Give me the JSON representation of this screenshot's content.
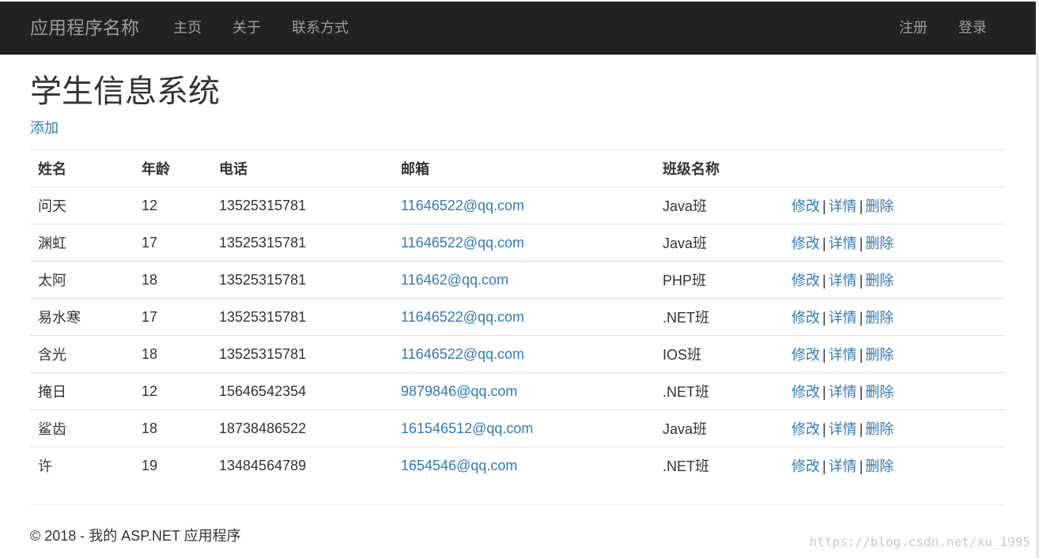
{
  "navbar": {
    "brand": "应用程序名称",
    "links": [
      "主页",
      "关于",
      "联系方式"
    ],
    "right_links": [
      "注册",
      "登录"
    ]
  },
  "main": {
    "title": "学生信息系统",
    "add_link": "添加"
  },
  "table": {
    "headers": [
      "姓名",
      "年龄",
      "电话",
      "邮箱",
      "班级名称",
      ""
    ],
    "action_labels": {
      "edit": "修改",
      "details": "详情",
      "delete": "删除",
      "separator": "|"
    },
    "rows": [
      {
        "name": "问天",
        "age": "12",
        "phone": "13525315781",
        "email": "11646522@qq.com",
        "class": "Java班"
      },
      {
        "name": "渊虹",
        "age": "17",
        "phone": "13525315781",
        "email": "11646522@qq.com",
        "class": "Java班"
      },
      {
        "name": "太阿",
        "age": "18",
        "phone": "13525315781",
        "email": "116462@qq.com",
        "class": "PHP班"
      },
      {
        "name": "易水寒",
        "age": "17",
        "phone": "13525315781",
        "email": "11646522@qq.com",
        "class": ".NET班"
      },
      {
        "name": "含光",
        "age": "18",
        "phone": "13525315781",
        "email": "11646522@qq.com",
        "class": "IOS班"
      },
      {
        "name": "掩日",
        "age": "12",
        "phone": "15646542354",
        "email": "9879846@qq.com",
        "class": ".NET班"
      },
      {
        "name": "鲨齿",
        "age": "18",
        "phone": "18738486522",
        "email": "161546512@qq.com",
        "class": "Java班"
      },
      {
        "name": "许",
        "age": "19",
        "phone": "13484564789",
        "email": "1654546@qq.com",
        "class": ".NET班"
      }
    ]
  },
  "footer": {
    "text": "© 2018 - 我的 ASP.NET 应用程序"
  },
  "watermark": "https://blog.csdn.net/xu_1995",
  "colors": {
    "navbar_bg": "#222222",
    "nav_text": "#9d9d9d",
    "link": "#337ab7",
    "text": "#333333",
    "border": "#dddddd"
  }
}
